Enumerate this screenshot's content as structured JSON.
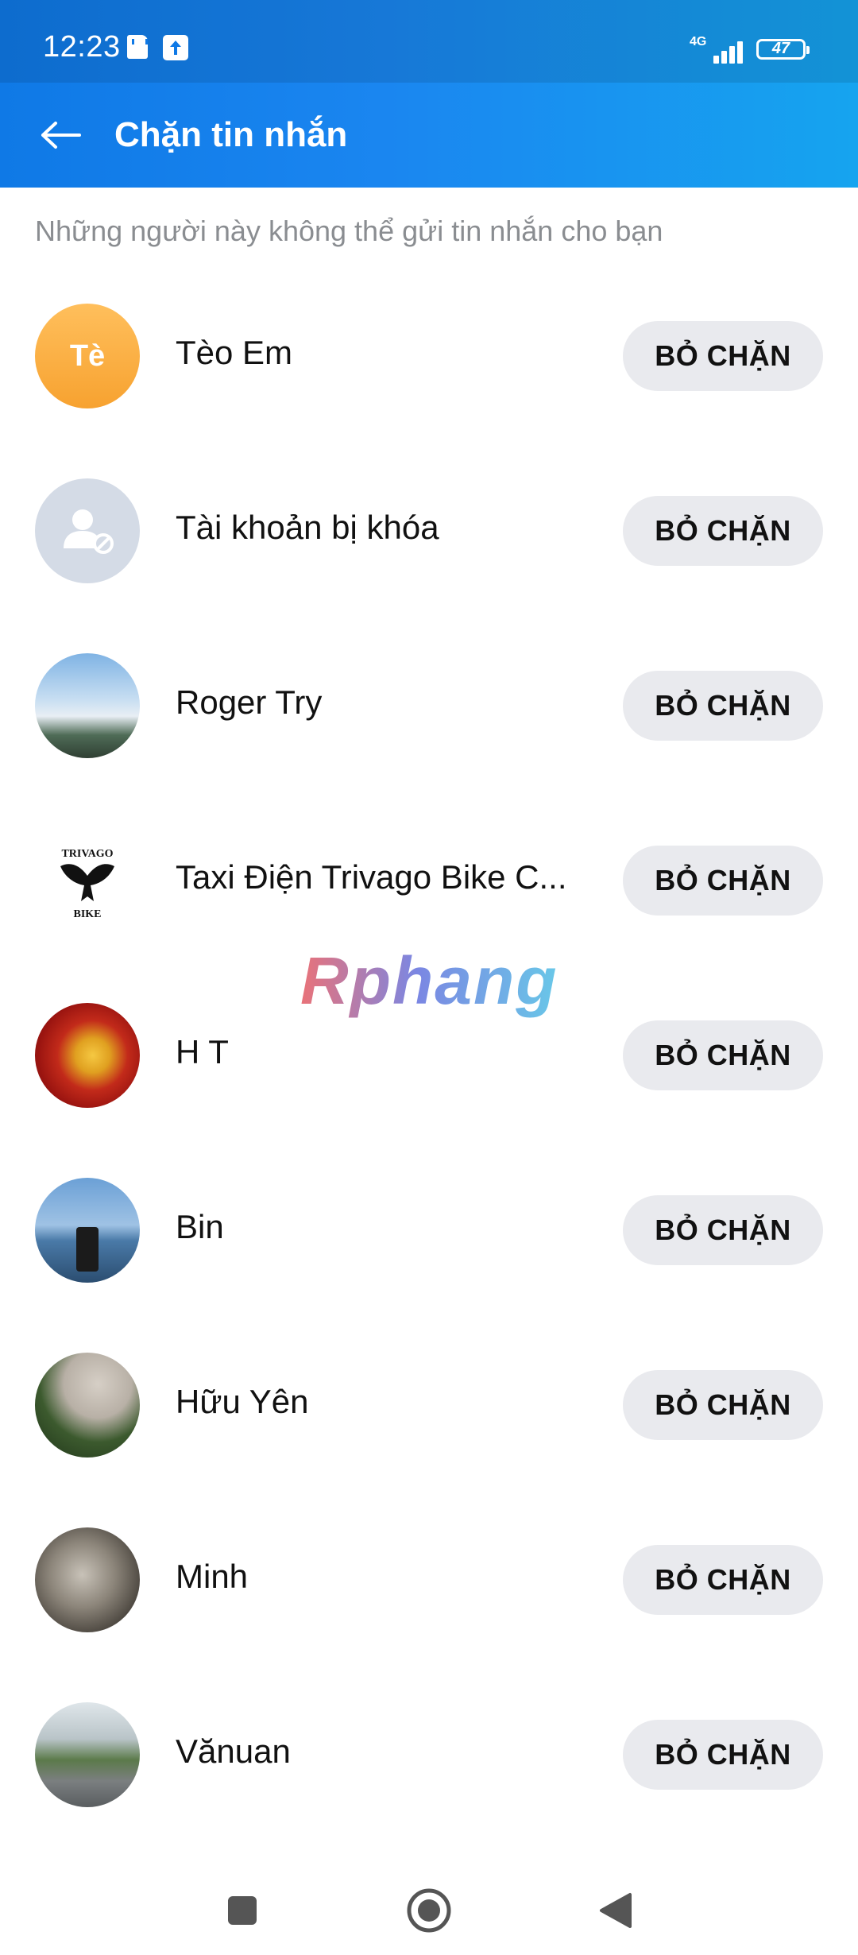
{
  "status_bar": {
    "time": "12:23",
    "network": "4G",
    "battery": "47"
  },
  "app_bar": {
    "title": "Chặn tin nhắn",
    "back_icon": "arrow-left-icon"
  },
  "subtitle": "Những người này không thể gửi tin nhắn cho bạn",
  "unblock_label": "BỎ CHẶN",
  "contacts": [
    {
      "name": "Tèo Em",
      "initials": "Tè",
      "avatar": "initials-orange"
    },
    {
      "name": "Tài khoản bị khóa",
      "avatar": "locked-account-icon"
    },
    {
      "name": "Roger Try",
      "avatar": "sky-mountain-photo"
    },
    {
      "name": "Taxi Điện Trivago Bike C...",
      "avatar": "trivago-bike-logo",
      "logo_text_top": "TRIVAGO",
      "logo_text_bottom": "BIKE"
    },
    {
      "name": "H T",
      "avatar": "red-emblem-photo"
    },
    {
      "name": "Bin",
      "avatar": "sea-drink-photo"
    },
    {
      "name": "Hữu Yên",
      "avatar": "trees-sky-photo"
    },
    {
      "name": "Minh",
      "avatar": "selfie-photo"
    },
    {
      "name": "Vănuan",
      "avatar": "street-photo"
    }
  ],
  "watermark": "Rphang",
  "nav": {
    "recents_icon": "square-icon",
    "home_icon": "circle-home-icon",
    "back_icon": "triangle-back-icon"
  }
}
